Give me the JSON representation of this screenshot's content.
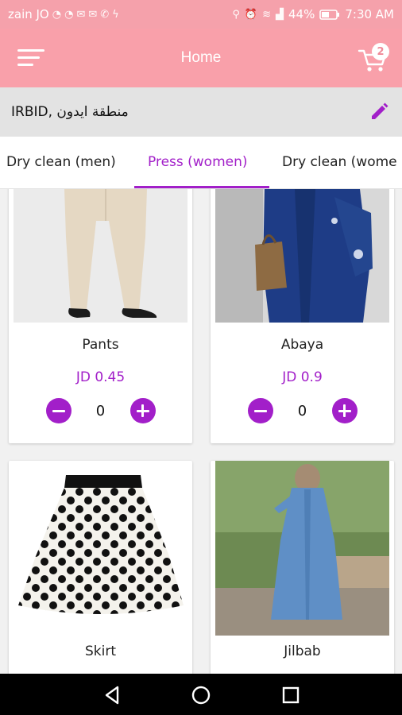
{
  "status_bar": {
    "carrier": "zain JO",
    "icons": [
      "whatsapp-icon",
      "whatsapp-icon",
      "mail-icon",
      "mail-icon",
      "phone-icon",
      "charging-icon",
      "location-icon",
      "alarm-icon",
      "wifi-icon",
      "signal-icon",
      "battery-icon"
    ],
    "battery": "44%",
    "time": "7:30 AM"
  },
  "app_bar": {
    "title": "Home",
    "cart_count": "2",
    "background": "#f9a0aa"
  },
  "location": {
    "text": "IRBID, منطقة ايدون"
  },
  "tabs": [
    {
      "label": "Dry clean (men)",
      "active": false
    },
    {
      "label": "Press (women)",
      "active": true
    },
    {
      "label": "Dry clean (wome",
      "active": false
    }
  ],
  "accent": "#a21fc9",
  "products": [
    {
      "name": "Pants",
      "price": "JD 0.45",
      "qty": "0"
    },
    {
      "name": "Abaya",
      "price": "JD 0.9",
      "qty": "0"
    },
    {
      "name": "Skirt"
    },
    {
      "name": "Jilbab"
    }
  ],
  "nav": {
    "icons": [
      "back-icon",
      "home-icon",
      "recents-icon"
    ]
  }
}
